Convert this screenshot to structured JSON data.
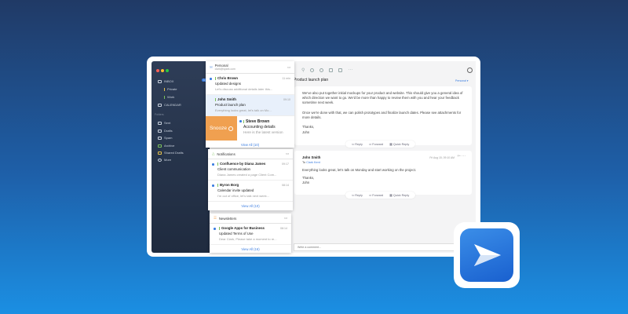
{
  "sidebar": {
    "inbox": "INBOX",
    "inbox_count": "1",
    "private": "Private",
    "work": "Work",
    "calendar": "CALENDAR",
    "folders": "Folders",
    "items": [
      "Sent",
      "Drafts",
      "Spam",
      "Archive",
      "Shared Drafts",
      "More"
    ]
  },
  "personal": {
    "title": "Personal",
    "email": "clark@spark.com",
    "mails": [
      {
        "from": "Chris Brown",
        "subject": "Updated designs",
        "preview": "Let's discuss additional details later this...",
        "time": "11 min"
      },
      {
        "from": "John Smith",
        "subject": "Product launch plan",
        "preview": "Everything looks great, let's talk on Mo...",
        "time": "09:10"
      },
      {
        "from": "Steve Brown",
        "subject": "Accounting details",
        "preview": "Here is the latest version"
      }
    ],
    "snooze": "Snooze",
    "view_all": "View All (10)"
  },
  "notifications": {
    "title": "Notifications",
    "mails": [
      {
        "from": "Confluence by Diana James",
        "subject": "Client communication",
        "preview": "Diana James created a page Client Com...",
        "time": "09:17"
      },
      {
        "from": "Byron Borg",
        "subject": "Calendar invite updated",
        "preview": "I'm out of office, let's talk next week...",
        "time": "08:14"
      }
    ],
    "view_all": "View All (10)"
  },
  "newsletters": {
    "title": "Newsletters",
    "mails": [
      {
        "from": "Google Apps for Business",
        "subject": "Updated Terms of Use",
        "preview": "Dear Clark, Please take a moment to re...",
        "time": "08:14"
      }
    ],
    "view_all": "View All (16)"
  },
  "thread": {
    "title": "Product launch plan",
    "account": "Personal",
    "msg1": {
      "p1": "We've also put together initial mockups for your product and website. This should give you a general idea of which direction we want to go. We'd be more than happy to review them with you and hear your feedback sometime next week.",
      "p2": "Once we're done with that, we can polish prototypes and finalize launch dates. Please see attachments for more details.",
      "sign1": "Thanks,",
      "sign2": "John"
    },
    "msg2": {
      "from": "John Smith",
      "to_label": "To",
      "to": "Clark Kent",
      "date": "Fri Aug 15, 09:10 AM",
      "body": "Everything looks great, let's talk on Monday and start working on the project.",
      "sign1": "Thanks,",
      "sign2": "John"
    },
    "reply": "Reply",
    "forward": "Forward",
    "quick_reply": "Quick Reply",
    "comment_placeholder": "Write a comment..."
  }
}
